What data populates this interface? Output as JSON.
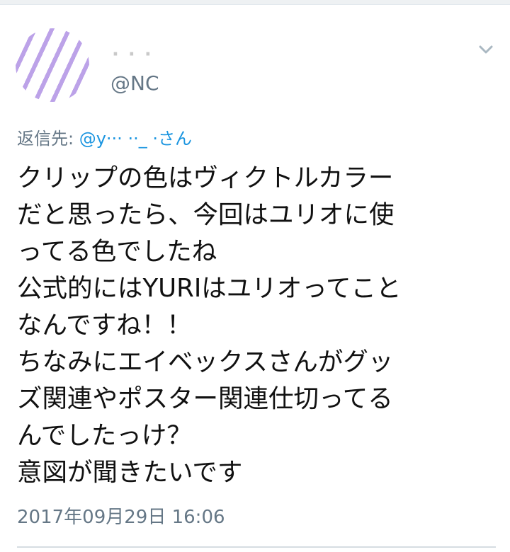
{
  "tweet": {
    "handle": "@NC",
    "reply_label": "返信先: ",
    "reply_user": "@y··· ··_ ·さん",
    "lines": [
      "クリップの色はヴィクトルカラー",
      "だと思ったら、今回はユリオに使",
      "ってる色でしたね",
      "公式的にはYURIはユリオってこと",
      "なんですね！！",
      "ちなみにエイベックスさんがグッ",
      "ズ関連やポスター関連仕切ってる",
      "んでしたっけ？",
      "意図が聞きたいです"
    ],
    "timestamp": "2017年09月29日 16:06"
  },
  "icons": {
    "more": "chevron-down-icon"
  },
  "colors": {
    "link": "#1b95e0",
    "secondary_text": "#657786",
    "primary_text": "#111111"
  }
}
